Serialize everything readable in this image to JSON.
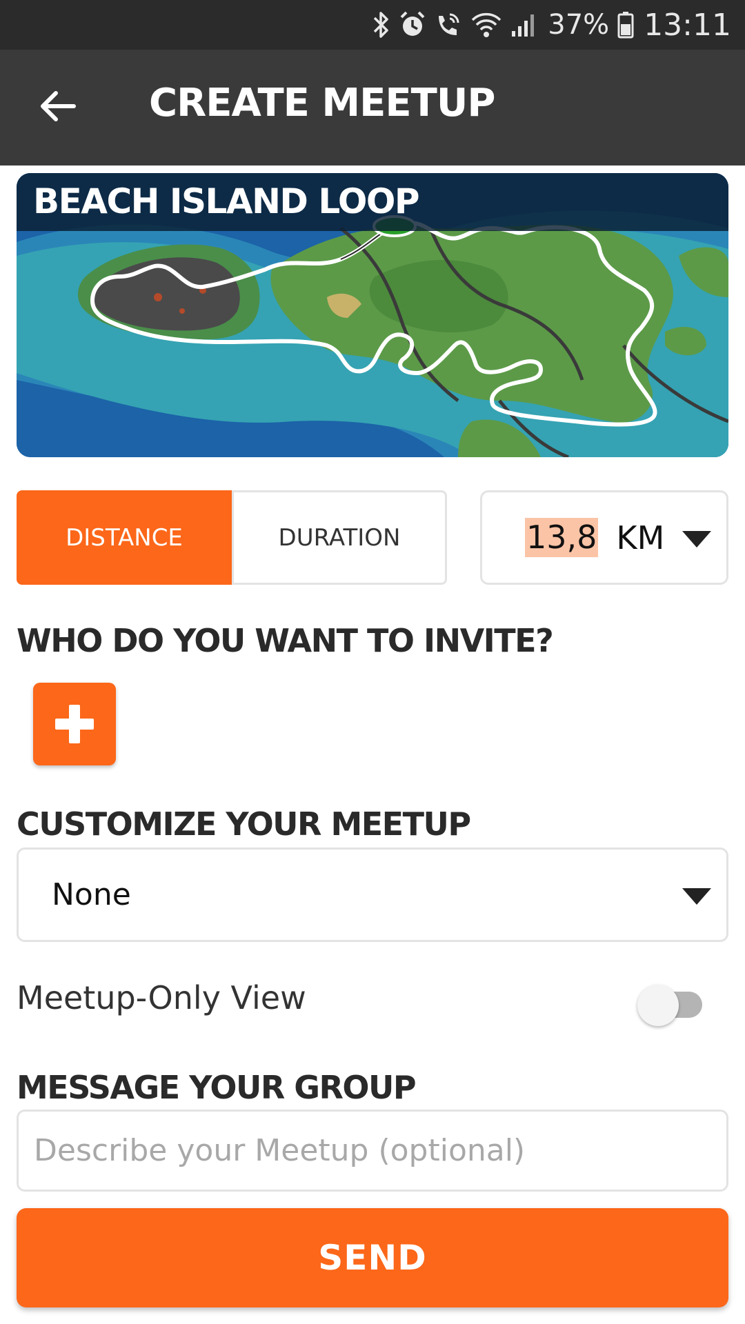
{
  "colors": {
    "accent": "#fc6719",
    "status_bar_bg": "#2b2b2b",
    "app_bar_bg": "#3a3a3a",
    "heading_text": "#2a2a2a",
    "border": "#e3e3e3",
    "value_highlight": "#fbc4a6"
  },
  "status_bar": {
    "icons": [
      "bluetooth-icon",
      "alarm-icon",
      "wifi-calling-icon",
      "wifi-icon",
      "signal-icon",
      "battery-icon"
    ],
    "battery": "37%",
    "time": "13:11"
  },
  "app_bar": {
    "back_icon": "arrow-left-icon",
    "title": "CREATE MEETUP"
  },
  "route": {
    "name": "BEACH ISLAND LOOP"
  },
  "mode": {
    "options": [
      "DISTANCE",
      "DURATION"
    ],
    "selected": "DISTANCE"
  },
  "distance": {
    "value": "13,8",
    "unit": "KM"
  },
  "invite": {
    "heading": "WHO DO YOU WANT TO INVITE?",
    "add_icon": "plus-icon"
  },
  "customize": {
    "heading": "CUSTOMIZE YOUR MEETUP",
    "selected": "None"
  },
  "meetup_only_view": {
    "label": "Meetup-Only View",
    "enabled": false
  },
  "message": {
    "heading": "MESSAGE YOUR GROUP",
    "placeholder": "Describe your Meetup (optional)",
    "value": ""
  },
  "send": {
    "label": "SEND"
  }
}
